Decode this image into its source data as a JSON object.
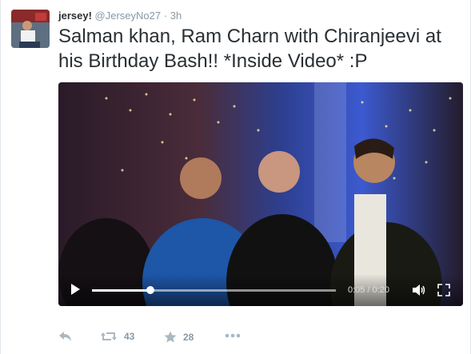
{
  "tweet": {
    "name": "jersey!",
    "handle": "@JerseyNo27",
    "separator": "·",
    "time": "3h",
    "text": "Salman khan, Ram Charn with Chiranjeevi at his Birthday Bash!! *Inside Video* :P"
  },
  "video": {
    "current_time": "0:05",
    "duration": "0:20",
    "timecode": "0:05 / 0:20",
    "progress": 0.24
  },
  "actions": {
    "retweet_count": "43",
    "favorite_count": "28"
  },
  "icons": {
    "reply": "reply-icon",
    "retweet": "retweet-icon",
    "favorite": "star-icon",
    "more": "more-icon",
    "play": "play-icon",
    "volume": "volume-icon",
    "fullscreen": "fullscreen-icon"
  },
  "colors": {
    "text": "#292f33",
    "muted": "#8899a6",
    "border": "#e1e8ed"
  }
}
